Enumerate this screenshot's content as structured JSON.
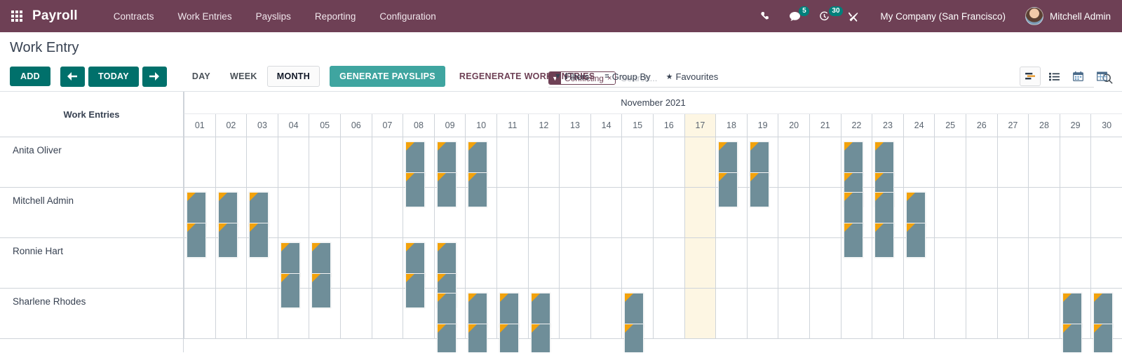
{
  "navbar": {
    "apps_icon": "apps-grid-icon",
    "brand": "Payroll",
    "menu": [
      {
        "label": "Contracts"
      },
      {
        "label": "Work Entries"
      },
      {
        "label": "Payslips"
      },
      {
        "label": "Reporting"
      },
      {
        "label": "Configuration"
      }
    ],
    "icons": [
      {
        "name": "phone-icon",
        "badge": ""
      },
      {
        "name": "messages-icon",
        "badge": "5"
      },
      {
        "name": "activities-clock-icon",
        "badge": "30"
      },
      {
        "name": "debug-tools-icon",
        "badge": ""
      }
    ],
    "company": "My Company (San Francisco)",
    "user": "Mitchell Admin",
    "brand_color": "#6e4055",
    "badge_color": "#00807b"
  },
  "control_panel": {
    "title": "Work Entry",
    "add_label": "ADD",
    "prev_label": "←",
    "today_label": "TODAY",
    "next_label": "→",
    "scales": [
      {
        "label": "DAY",
        "active": false
      },
      {
        "label": "WEEK",
        "active": false
      },
      {
        "label": "MONTH",
        "active": true
      }
    ],
    "generate_payslips_label": "GENERATE PAYSLIPS",
    "regenerate_label": "REGENERATE WORK ENTRIES",
    "filters_label": "Filters",
    "group_by_label": "Group By",
    "favourites_label": "Favourites",
    "accent_color": "#00706b",
    "secondary_color": "#3fa5a0"
  },
  "search": {
    "facet_label": "Conflicting",
    "facet_remove": "×",
    "placeholder": "Search...",
    "value": "",
    "magnifier": "search-icon"
  },
  "view_switcher": [
    {
      "name": "gantt-view",
      "active": true
    },
    {
      "name": "list-view",
      "active": false
    },
    {
      "name": "calendar-view",
      "active": false
    },
    {
      "name": "pivot-view",
      "active": false
    }
  ],
  "gantt": {
    "row_header": "Work Entries",
    "period_title": "November 2021",
    "days": [
      "01",
      "02",
      "03",
      "04",
      "05",
      "06",
      "07",
      "08",
      "09",
      "10",
      "11",
      "12",
      "13",
      "14",
      "15",
      "16",
      "17",
      "18",
      "19",
      "20",
      "21",
      "22",
      "23",
      "24",
      "25",
      "26",
      "27",
      "28",
      "29",
      "30"
    ],
    "today_index": 16,
    "bar_color": "#6f8e99",
    "conflict_color": "#f2a20c",
    "today_color": "#fdf6e3",
    "rows": [
      {
        "name": "Anita Oliver",
        "bars": [
          {
            "day": 8,
            "slot": 0,
            "conflict": true
          },
          {
            "day": 8,
            "slot": 1,
            "conflict": true
          },
          {
            "day": 9,
            "slot": 0,
            "conflict": true
          },
          {
            "day": 9,
            "slot": 1,
            "conflict": true
          },
          {
            "day": 10,
            "slot": 0,
            "conflict": true
          },
          {
            "day": 10,
            "slot": 1,
            "conflict": true
          },
          {
            "day": 18,
            "slot": 0,
            "conflict": true
          },
          {
            "day": 18,
            "slot": 1,
            "conflict": true
          },
          {
            "day": 19,
            "slot": 0,
            "conflict": true
          },
          {
            "day": 19,
            "slot": 1,
            "conflict": true
          },
          {
            "day": 22,
            "slot": 0,
            "conflict": true
          },
          {
            "day": 22,
            "slot": 1,
            "conflict": true
          },
          {
            "day": 23,
            "slot": 0,
            "conflict": true
          },
          {
            "day": 23,
            "slot": 1,
            "conflict": true
          }
        ]
      },
      {
        "name": "Mitchell Admin",
        "bars": [
          {
            "day": 1,
            "slot": 0,
            "conflict": true
          },
          {
            "day": 1,
            "slot": 1,
            "conflict": true
          },
          {
            "day": 2,
            "slot": 0,
            "conflict": true
          },
          {
            "day": 2,
            "slot": 1,
            "conflict": true
          },
          {
            "day": 3,
            "slot": 0,
            "conflict": true
          },
          {
            "day": 3,
            "slot": 1,
            "conflict": true
          },
          {
            "day": 22,
            "slot": 0,
            "conflict": true
          },
          {
            "day": 22,
            "slot": 1,
            "conflict": true
          },
          {
            "day": 23,
            "slot": 0,
            "conflict": true
          },
          {
            "day": 23,
            "slot": 1,
            "conflict": true
          },
          {
            "day": 24,
            "slot": 0,
            "conflict": true
          },
          {
            "day": 24,
            "slot": 1,
            "conflict": true
          }
        ]
      },
      {
        "name": "Ronnie Hart",
        "bars": [
          {
            "day": 4,
            "slot": 0,
            "conflict": true
          },
          {
            "day": 4,
            "slot": 1,
            "conflict": true
          },
          {
            "day": 5,
            "slot": 0,
            "conflict": true
          },
          {
            "day": 5,
            "slot": 1,
            "conflict": true
          },
          {
            "day": 8,
            "slot": 0,
            "conflict": true
          },
          {
            "day": 8,
            "slot": 1,
            "conflict": true
          },
          {
            "day": 9,
            "slot": 0,
            "conflict": true
          },
          {
            "day": 9,
            "slot": 1,
            "conflict": true
          }
        ]
      },
      {
        "name": "Sharlene Rhodes",
        "bars": [
          {
            "day": 9,
            "slot": 0,
            "conflict": true
          },
          {
            "day": 9,
            "slot": 1,
            "conflict": true
          },
          {
            "day": 10,
            "slot": 0,
            "conflict": true
          },
          {
            "day": 10,
            "slot": 1,
            "conflict": true
          },
          {
            "day": 11,
            "slot": 0,
            "conflict": true
          },
          {
            "day": 11,
            "slot": 1,
            "conflict": true
          },
          {
            "day": 12,
            "slot": 0,
            "conflict": true
          },
          {
            "day": 12,
            "slot": 1,
            "conflict": true
          },
          {
            "day": 15,
            "slot": 0,
            "conflict": true
          },
          {
            "day": 15,
            "slot": 1,
            "conflict": true
          },
          {
            "day": 29,
            "slot": 0,
            "conflict": true
          },
          {
            "day": 29,
            "slot": 1,
            "conflict": true
          },
          {
            "day": 30,
            "slot": 0,
            "conflict": true
          },
          {
            "day": 30,
            "slot": 1,
            "conflict": true
          }
        ]
      }
    ]
  }
}
